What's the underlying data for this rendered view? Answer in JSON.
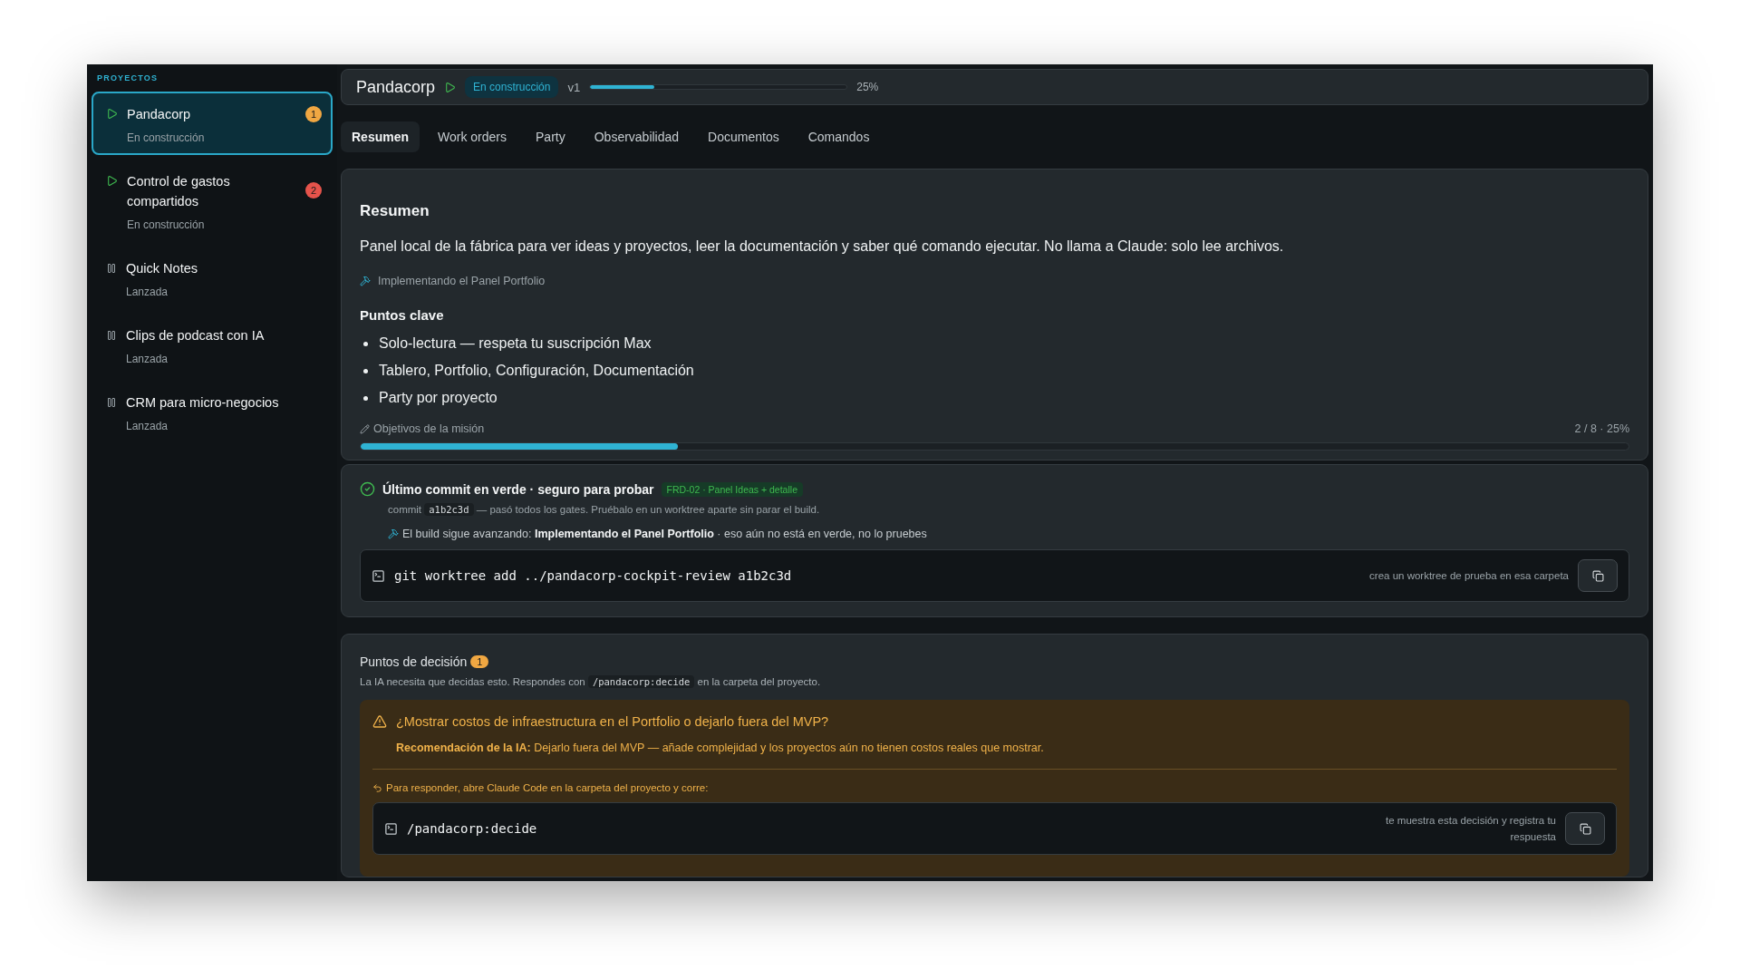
{
  "sidebar": {
    "heading": "PROYECTOS",
    "items": [
      {
        "kind": "running",
        "title": "Pandacorp",
        "status": "En construcción",
        "badge": "1",
        "color": "#f0a742",
        "selected": true
      },
      {
        "kind": "running",
        "title": "Control de gastos compartidos",
        "status": "En construcción",
        "badge": "2",
        "color": "#e5534b",
        "selected": false
      },
      {
        "kind": "paused",
        "title": "Quick Notes",
        "status": "Lanzada",
        "selected": false
      },
      {
        "kind": "paused",
        "title": "Clips de podcast con IA",
        "status": "Lanzada",
        "selected": false
      },
      {
        "kind": "paused",
        "title": "CRM para micro-negocios",
        "status": "Lanzada",
        "selected": false
      }
    ]
  },
  "header": {
    "title": "Pandacorp",
    "status": "En construcción",
    "version": "v1",
    "level": 0.25,
    "percent": "25%"
  },
  "tabs": [
    {
      "label": "Resumen",
      "selected": true
    },
    {
      "label": "Work orders",
      "selected": false
    },
    {
      "label": "Party",
      "selected": false
    },
    {
      "label": "Observabilidad",
      "selected": false
    },
    {
      "label": "Documentos",
      "selected": false
    },
    {
      "label": "Comandos",
      "selected": false
    }
  ],
  "summary": {
    "title": "Resumen",
    "description": "Panel local de la fábrica para ver ideas y proyectos, leer la documentación y saber qué comando ejecutar. No llama a Claude: solo lee archivos.",
    "current_task": "Implementando el Panel Portfolio",
    "key_points_title": "Puntos clave",
    "key_points": [
      "Solo-lectura — respeta tu suscripción Max",
      "Tablero, Portfolio, Configuración, Documentación",
      "Party por proyecto"
    ],
    "objectives_label": "Objetivos de la misión",
    "objectives_count": "2 / 8 · 25%",
    "level": 0.25
  },
  "commit": {
    "title": "Último commit en verde · seguro para probar",
    "tag": "FRD-02 · Panel Ideas + detalle",
    "line_prefix": "commit",
    "hash": "a1b2c3d",
    "line_suffix": "— pasó todos los gates. Pruébalo en un worktree aparte sin parar el build.",
    "build_note": "El build sigue avanzando: **Implementando el Panel Portfolio** · eso aún no está en verde, no lo pruebes",
    "command": "git worktree add ../pandacorp-cockpit-review a1b2c3d",
    "command_hint": "crea un worktree de prueba en esa carpeta"
  },
  "decisions": {
    "title": "Puntos de decisión",
    "count": "1",
    "intro_prefix": "La IA necesita que decidas esto. Respondes con",
    "intro_code": "/pandacorp:decide",
    "intro_suffix": "en la carpeta del proyecto.",
    "items": [
      {
        "question": "¿Mostrar costos de infraestructura en el Portfolio o dejarlo fuera del MVP?",
        "recommendation": "**Recomendación de la IA:** Dejarlo fuera del MVP — añade complejidad y los proyectos aún no tienen costos reales que mostrar.",
        "respond_hint": "Para responder, abre Claude Code en la carpeta del proyecto y corre:",
        "command": "/pandacorp:decide",
        "command_hint": "te muestra esta decisión y registra tu respuesta"
      }
    ]
  }
}
